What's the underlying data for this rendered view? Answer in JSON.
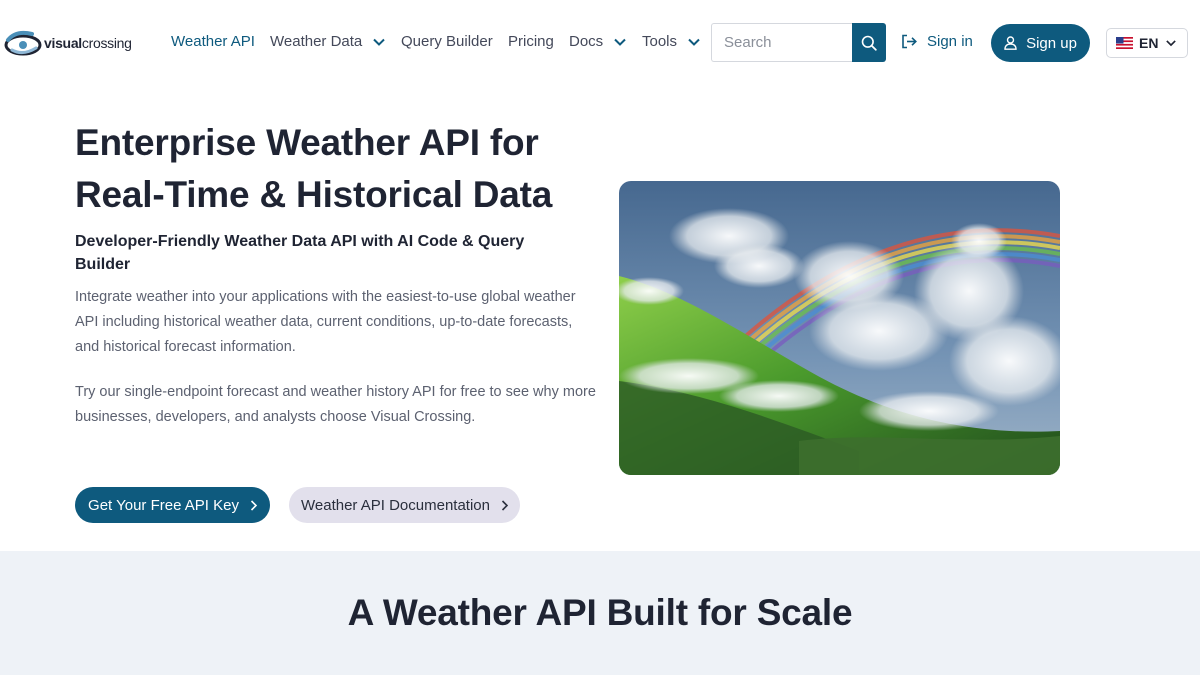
{
  "brand": {
    "name_bold": "visual",
    "name_rest": "crossing"
  },
  "nav": {
    "items": [
      {
        "label": "Weather API",
        "dropdown": false,
        "active": true
      },
      {
        "label": "Weather Data",
        "dropdown": true
      },
      {
        "label": "Query Builder",
        "dropdown": false
      },
      {
        "label": "Pricing",
        "dropdown": false
      },
      {
        "label": "Docs",
        "dropdown": true
      },
      {
        "label": "Tools",
        "dropdown": true
      }
    ],
    "search_placeholder": "Search",
    "signin_label": "Sign in",
    "signup_label": "Sign up",
    "language": "EN"
  },
  "hero": {
    "title": "Enterprise Weather API for Real-Time & Historical Data",
    "subtitle": "Developer-Friendly Weather Data API with AI Code & Query Builder",
    "paragraph1": "Integrate weather into your applications with the easiest-to-use global weather API including historical weather data, current conditions, up-to-date forecasts, and historical forecast information.",
    "paragraph2": "Try our single-endpoint forecast and weather history API for free to see why more businesses, developers, and analysts choose Visual Crossing.",
    "primary_button": "Get Your Free API Key",
    "secondary_button": "Weather API Documentation"
  },
  "scale_section": {
    "title": "A Weather API Built for Scale"
  },
  "colors": {
    "primary": "#0e5a7e",
    "secondary_button_bg": "#e2e0ec",
    "section_bg": "#eef2f7",
    "text_dark": "#1f2433",
    "text_muted": "#5c6170"
  }
}
